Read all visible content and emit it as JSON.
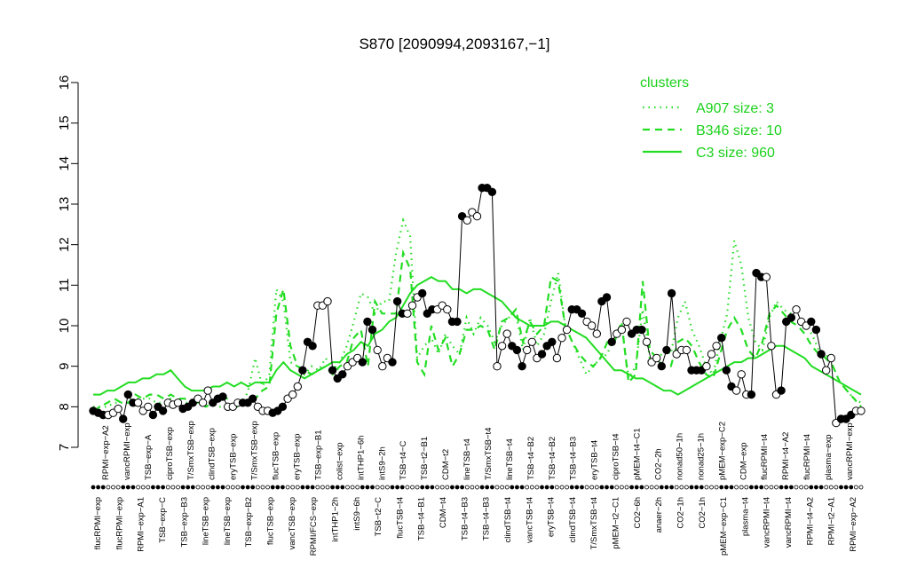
{
  "chart_data": {
    "type": "line",
    "title": "S870 [2090994,2093167,−1]",
    "xlabel": "",
    "ylabel": "",
    "ylim": [
      7,
      16
    ],
    "yticks": [
      7,
      8,
      9,
      10,
      11,
      12,
      13,
      14,
      15,
      16
    ],
    "grid": false,
    "legend": {
      "title": "clusters",
      "position": "top-right",
      "entries": [
        {
          "label": "A907 size: 3",
          "style": "dotted"
        },
        {
          "label": "B346 size: 10",
          "style": "dashed"
        },
        {
          "label": "C3 size: 960",
          "style": "solid"
        }
      ]
    },
    "colors": {
      "cluster_lines": "#22dd22",
      "legend_text": "#1bd11b",
      "points": "#000000",
      "open_points": "#ffffff"
    },
    "labels_top": [
      "RPMI−exp−A2",
      "vancRPMI−exp",
      "TSB−exp−A",
      "ciproTSB−exp",
      "T/SmxTSB−exp",
      "clindTSB−exp",
      "eryTSB−exp",
      "T/SmxTSB−exp",
      "flucTSB−exp",
      "eryTSB−exp",
      "TSB−exp−B1",
      "colist−exp",
      "intTHP1−6h",
      "intS9−2h",
      "TSB−t4−C",
      "TSB−t2−B1",
      "CDM−t2",
      "lineTSB−t4",
      "T/SmxTSB−t4",
      "lineTSB−t4",
      "TSB−t4−B2",
      "TSB−t4−B2",
      "TSB−t4−B3",
      "eryTSB−t4",
      "ciproTSB−t4",
      "pMEM−t4−C1",
      "CO2−2h",
      "nonad50−1h",
      "nonad25−1h",
      "pMEM−exp−C2",
      "CDM−exp",
      "flucRPMI−t4",
      "RPMI−t4−A2",
      "flucRPMI−t4",
      "plasma−exp",
      "vancRPMI−exp"
    ],
    "labels_bottom": [
      "flucRPMI−exp",
      "flucRPMI−exp",
      "RPMI−exp−A1",
      "TSB−exp−C",
      "TSB−exp−B3",
      "lineTSB−exp",
      "lineTSB−exp",
      "TSB−exp−B2",
      "flucTSB−exp",
      "vancTSB−exp",
      "RPMI/FCS−exp",
      "intTHP1−2h",
      "intS9−6h",
      "TSB−t2−C",
      "flucTSB−t4",
      "TSB−t4−B1",
      "CDM−t4",
      "TSB−t4−B3",
      "TSB−t4−B3",
      "clindTSB−t4",
      "vancTSB−t4",
      "eryTSB−t4",
      "clindTSB−t4",
      "T/SmxTSB−t4",
      "pMEM−t2−C1",
      "CO2−6h",
      "anaer−2h",
      "CO2−1h",
      "CO2−1h",
      "pMEM−exp−C1",
      "plasma−t4",
      "vancRPMI−t4",
      "vancRPMI−t4",
      "RPMI−t4−A2",
      "RPMI−t2−A1",
      "RPMI−exp−A2"
    ],
    "series": [
      {
        "name": "A907 size: 3",
        "style": "dotted",
        "values": [
          8.0,
          8.0,
          8.0,
          8.1,
          8.1,
          8.1,
          8.2,
          8.2,
          8.2,
          8.1,
          8.1,
          8.2,
          8.1,
          8.1,
          8.1,
          8.1,
          8.1,
          8.1,
          8.0,
          8.0,
          8.0,
          8.0,
          8.4,
          9.2,
          8.5,
          8.8,
          10.9,
          10.6,
          9.1,
          9.0,
          8.8,
          9.0,
          8.9,
          9.2,
          8.9,
          9.1,
          9.5,
          10.1,
          10.8,
          10.7,
          10.3,
          10.6,
          10.6,
          11.8,
          12.6,
          12.2,
          9.2,
          9.5,
          9.7,
          9.3,
          9.8,
          9.5,
          9.3,
          10.2,
          9.8,
          10.2,
          10.0,
          9.6,
          10.0,
          10.2,
          10.3,
          9.4,
          10.2,
          9.5,
          9.8,
          10.6,
          11.3,
          10.0,
          9.6,
          9.2,
          8.8,
          9.0,
          9.2,
          9.3,
          9.8,
          10.0,
          8.7,
          9.0,
          10.4,
          9.2,
          9.1,
          9.4,
          9.3,
          10.2,
          10.6,
          9.9,
          9.5,
          9.0,
          8.8,
          9.6,
          10.3,
          12.1,
          11.5,
          10.2,
          9.6,
          9.4,
          10.2,
          10.6,
          10.4,
          10.3,
          10.1,
          10.0,
          9.8,
          9.4,
          9.3,
          9.0,
          8.6,
          8.4,
          8.2,
          8.1
        ]
      },
      {
        "name": "B346 size: 10",
        "style": "dashed",
        "values": [
          7.9,
          8.0,
          8.1,
          8.2,
          8.1,
          8.1,
          8.3,
          8.2,
          8.3,
          8.3,
          8.2,
          8.3,
          8.2,
          8.2,
          8.1,
          8.1,
          8.0,
          8.1,
          8.3,
          8.2,
          8.0,
          8.1,
          8.1,
          8.2,
          8.4,
          8.5,
          10.3,
          10.9,
          9.5,
          9.0,
          8.9,
          8.8,
          8.9,
          9.0,
          8.8,
          9.0,
          9.1,
          9.7,
          9.9,
          9.0,
          10.6,
          10.3,
          10.3,
          10.3,
          11.8,
          11.4,
          9.1,
          8.8,
          10.0,
          9.4,
          9.7,
          9.0,
          9.3,
          9.9,
          9.9,
          10.0,
          9.9,
          9.4,
          10.1,
          10.2,
          10.4,
          9.6,
          10.1,
          9.8,
          10.0,
          11.2,
          11.1,
          10.0,
          9.6,
          9.3,
          9.1,
          9.0,
          9.2,
          9.6,
          9.6,
          10.1,
          8.6,
          8.8,
          11.1,
          9.4,
          9.2,
          9.0,
          9.0,
          9.6,
          9.7,
          9.5,
          9.1,
          8.8,
          8.7,
          9.3,
          9.9,
          10.2,
          9.9,
          9.4,
          9.2,
          9.6,
          10.3,
          10.5,
          10.3,
          10.1,
          10.0,
          9.8,
          9.5,
          9.3,
          9.2,
          9.0,
          8.6,
          8.4,
          8.2,
          8.0
        ]
      },
      {
        "name": "C3 size: 960",
        "style": "solid",
        "values": [
          8.3,
          8.3,
          8.4,
          8.4,
          8.5,
          8.6,
          8.6,
          8.7,
          8.7,
          8.8,
          8.8,
          8.9,
          8.7,
          8.5,
          8.4,
          8.4,
          8.4,
          8.5,
          8.5,
          8.6,
          8.5,
          8.6,
          8.5,
          8.6,
          8.6,
          8.6,
          8.9,
          9.1,
          8.9,
          8.8,
          8.7,
          8.8,
          8.9,
          9.0,
          9.1,
          9.1,
          9.3,
          9.4,
          9.6,
          9.5,
          9.8,
          9.9,
          10.1,
          10.2,
          10.5,
          10.8,
          11.0,
          11.1,
          11.2,
          11.1,
          11.1,
          10.9,
          10.9,
          10.8,
          10.9,
          10.9,
          10.8,
          10.7,
          10.6,
          10.4,
          10.2,
          10.1,
          10.0,
          10.0,
          10.0,
          10.1,
          10.1,
          10.0,
          9.9,
          9.8,
          9.7,
          9.5,
          9.3,
          9.1,
          8.9,
          8.9,
          8.8,
          8.7,
          8.7,
          8.6,
          8.5,
          8.4,
          8.4,
          8.3,
          8.4,
          8.5,
          8.6,
          8.7,
          8.8,
          8.9,
          9.0,
          9.1,
          9.1,
          9.2,
          9.2,
          9.3,
          9.4,
          9.5,
          9.5,
          9.4,
          9.3,
          9.2,
          9.0,
          8.9,
          8.8,
          8.7,
          8.6,
          8.5,
          8.4,
          8.3
        ]
      },
      {
        "name": "",
        "style": "points",
        "values": [
          7.9,
          7.85,
          7.8,
          7.8,
          7.85,
          7.95,
          7.7,
          8.3,
          8.1,
          8.1,
          7.9,
          8.0,
          7.8,
          8.0,
          7.9,
          8.1,
          8.05,
          8.1,
          7.95,
          8.0,
          8.1,
          8.2,
          8.1,
          8.4,
          8.1,
          8.2,
          8.25,
          8.0,
          8.0,
          8.1,
          8.1,
          8.1,
          8.2,
          8.0,
          7.9,
          7.9,
          7.85,
          7.9,
          8.0,
          8.2,
          8.3,
          8.5,
          8.9,
          9.6,
          9.5,
          10.5,
          10.5,
          10.6,
          8.9,
          8.7,
          8.8,
          9.0,
          9.1,
          9.2,
          9.1,
          10.1,
          9.9,
          9.4,
          9.0,
          9.2,
          9.1,
          10.6,
          10.3,
          10.3,
          10.5,
          10.7,
          10.8,
          10.3,
          10.4,
          10.4,
          10.5,
          10.4,
          10.1,
          10.1,
          12.7,
          12.6,
          12.8,
          12.7,
          13.4,
          13.4,
          13.3,
          9.0,
          9.5,
          9.8,
          9.5,
          9.4,
          9.0,
          9.4,
          9.6,
          9.2,
          9.3,
          9.5,
          9.6,
          9.2,
          9.7,
          9.9,
          10.4,
          10.4,
          10.3,
          10.1,
          10.0,
          9.8,
          10.6,
          10.7,
          9.6,
          9.8,
          9.9,
          10.1,
          9.8,
          9.9,
          9.9,
          9.6,
          9.1,
          9.2,
          9.0,
          9.4,
          10.8,
          9.3,
          9.4,
          9.4,
          8.9,
          8.9,
          8.9,
          9.0,
          9.3,
          9.5,
          9.7,
          8.9,
          8.5,
          8.4,
          8.8,
          8.3,
          8.3,
          11.3,
          11.2,
          11.2,
          9.5,
          8.3,
          8.4,
          10.1,
          10.2,
          10.4,
          10.1,
          10.0,
          10.1,
          9.9,
          9.3,
          8.9,
          9.2,
          7.6,
          7.7,
          7.7,
          7.8,
          7.9,
          7.9
        ]
      }
    ]
  }
}
